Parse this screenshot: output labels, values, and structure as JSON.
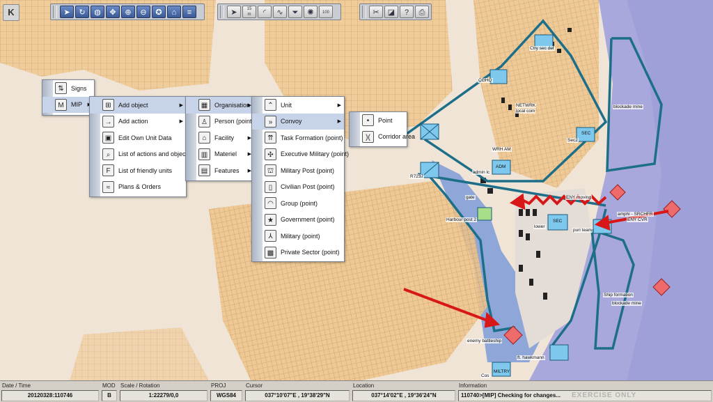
{
  "toolbar1": {
    "icons": [
      "cursor-icon",
      "refresh-icon",
      "globe-icon",
      "pan-icon",
      "zoom-in-icon",
      "zoom-out-icon",
      "compass-icon",
      "home-icon",
      "menu-icon"
    ]
  },
  "toolbar2": {
    "icons": [
      "select-icon",
      "scale-15m-icon",
      "area-icon",
      "profile-icon",
      "filter-icon",
      "sun-icon",
      "scale-100-icon"
    ],
    "scale_label": "15",
    "unit_label": "m",
    "scale100_label": "100"
  },
  "toolbar3": {
    "icons": [
      "tools-icon",
      "edit-icon",
      "help-icon",
      "print-icon"
    ]
  },
  "menus": {
    "root": [
      {
        "label": "Signs"
      },
      {
        "label": "MIP"
      }
    ],
    "mip": [
      {
        "label": "Add object"
      },
      {
        "label": "Add action"
      },
      {
        "label": "Edit Own Unit Data"
      },
      {
        "label": "List of actions and objects"
      },
      {
        "label": "List of friendly units"
      },
      {
        "label": "Plans & Orders"
      }
    ],
    "add_object": [
      {
        "label": "Organisation"
      },
      {
        "label": "Person (point)"
      },
      {
        "label": "Facility"
      },
      {
        "label": "Materiel"
      },
      {
        "label": "Features"
      }
    ],
    "organisation": [
      {
        "label": "Unit"
      },
      {
        "label": "Convoy"
      },
      {
        "label": "Task Formation (point)"
      },
      {
        "label": "Executive Military (point)"
      },
      {
        "label": "Military Post (point)"
      },
      {
        "label": "Civilian Post (point)"
      },
      {
        "label": "Group (point)"
      },
      {
        "label": "Government (point)"
      },
      {
        "label": "Military (point)"
      },
      {
        "label": "Private Sector (point)"
      }
    ],
    "convoy": [
      {
        "label": "Point"
      },
      {
        "label": "Corridor area"
      }
    ]
  },
  "map_labels": {
    "ctry_sec_def": "Ctry sec def",
    "cghq": "CGHQ",
    "netwrk": "NETWRK",
    "local_com": "local com",
    "sec": "SEC",
    "sec2": "Sec2",
    "wrh_am": "WRH AM",
    "adm": "ADM",
    "admin_lc": "admin lc",
    "r7237": "R7237",
    "gate": "gate",
    "harbour_post": "Harbour post 2",
    "enemy_moving": "ENY moving",
    "lower": "lower",
    "puri_team": "puri team",
    "amphi": "amphi - SRCHFR",
    "eny_cvr": "ENY CVR",
    "blockade_mine": "blockade mine",
    "ship_formation": "Ship formation",
    "enemy_battleship": "enemy battleship",
    "ft_hawkmann": "ft. hawkmann",
    "militry": "MILTRY",
    "cos": "Cos"
  },
  "status": {
    "date_label": "Date / Time",
    "date_value": "20120328:110746",
    "mod_label": "MOD",
    "mod_value": "B",
    "scale_label": "Scale / Rotation",
    "scale_value": "1:22279/0,0",
    "proj_label": "PROJ",
    "proj_value": "WGS84",
    "cursor_label": "Cursor",
    "cursor_value": "037°10'07\"E , 19°38'29\"N",
    "location_label": "Location",
    "location_value": "037°14'02\"E , 19°36'24\"N",
    "info_label": "Information",
    "info_value": "110740>[MIP] Checking for changes...",
    "watermark": "EXERCISE ONLY"
  },
  "colors": {
    "unit_fill": "#7ec8ee",
    "route": "#1d6e88",
    "enemy": "#ee6b6b",
    "arrow": "#d81818",
    "water": "#a9a8dc"
  }
}
